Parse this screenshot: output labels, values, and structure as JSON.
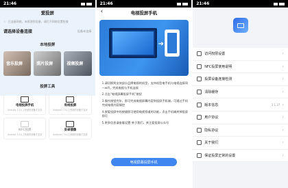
{
  "status_time": "21:46",
  "panel1": {
    "title": "爱投屏",
    "wifi_hint": "已连接网络，未探测到设备，请打开网络设置检查",
    "select_title": "请选择设备连接",
    "select_action": "设备未连接",
    "local_section": "本地投屏",
    "local_tiles": [
      "音乐投屏",
      "照片投屏",
      "视频投屏"
    ],
    "tools_section": "投屏工具",
    "tools": [
      {
        "name": "电视投屏手机",
        "desc": "Android 7.0以上系统的设备才支持",
        "dim": false
      },
      {
        "name": "有线投屏",
        "desc": "Android 7.0以上系统的设备才支持",
        "dim": false
      },
      {
        "name": "NFC投屏",
        "desc": "Android 7.0以上系统的设备才支持",
        "dim": true
      },
      {
        "name": "安卓镜像",
        "desc": "Android 7.0以上系统的设备才支持",
        "dim": false
      }
    ]
  },
  "panel2": {
    "back": "‹",
    "title": "电视投屏手机",
    "steps": [
      "1.请切换到支持部分品牌电视的机型，支持机型电手机与电视连接同一wifi，完成电视与手机连接",
      "2.点击\"电视屏幕投屏手机\"按钮",
      "3.操作按钮完毕，即可完成电视屏幕内容到投屏手机端，可通过手机完成电视内容操控",
      "4.按爱投屏中的按键即可使用电视频道的功能，点击手机端关掉投屏即可",
      "5.更多信息请查看设置-关于我们，关注爱投屏公众号"
    ],
    "cta": "电视屏幕投屏手机"
  },
  "panel3": {
    "menu": [
      {
        "label": "访问权限设置",
        "value": ""
      },
      {
        "label": "NFC投屏使用说明",
        "value": ""
      },
      {
        "label": "投屏设备连接检测",
        "value": ""
      },
      {
        "label": "清除缓存",
        "value": ""
      },
      {
        "label": "版本信息",
        "value": "3.1.37"
      },
      {
        "label": "用户协议",
        "value": ""
      },
      {
        "label": "隐私协议",
        "value": ""
      },
      {
        "label": "关于我们",
        "value": ""
      },
      {
        "label": "保证投屏正常的设置",
        "value": ""
      }
    ]
  },
  "colors": {
    "accent": "#3f86f0",
    "logo": "#2e6be6"
  }
}
